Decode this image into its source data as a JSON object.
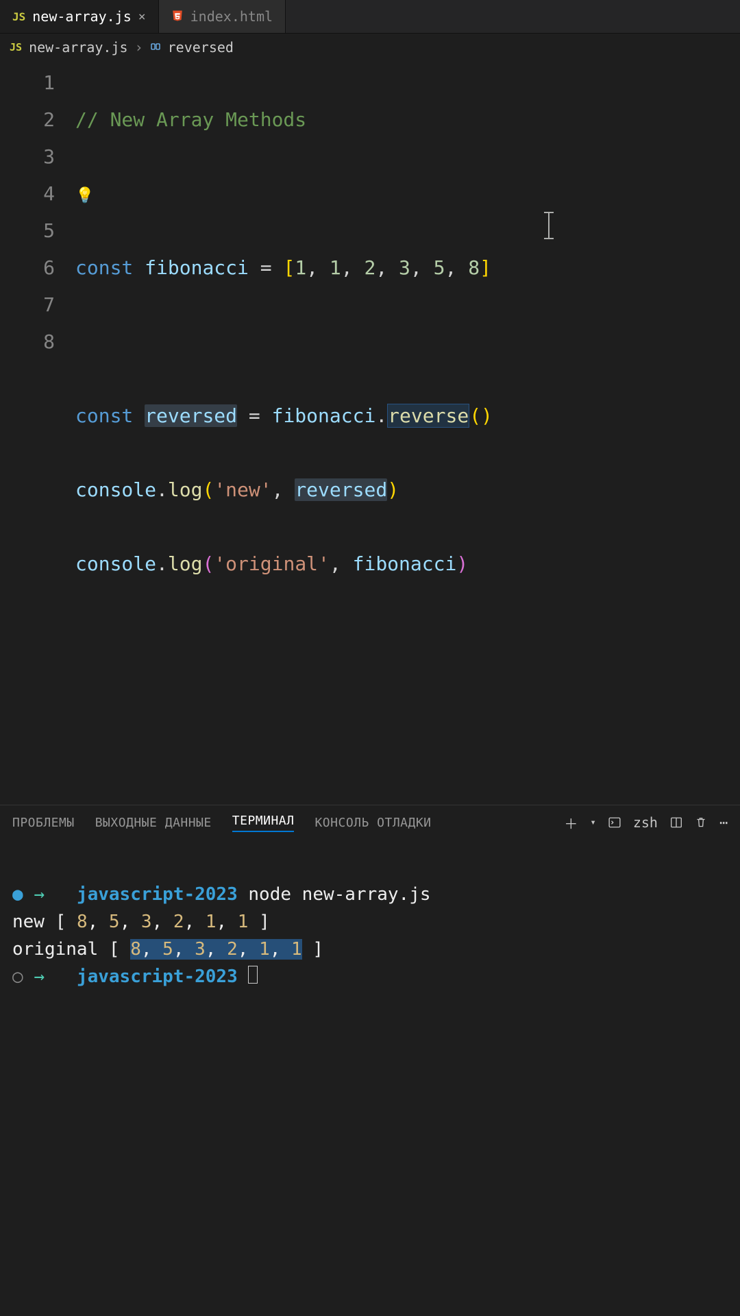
{
  "tabs": [
    {
      "icon": "JS",
      "label": "new-array.js",
      "active": true,
      "closeable": true
    },
    {
      "icon": "html",
      "label": "index.html",
      "active": false,
      "closeable": false
    }
  ],
  "breadcrumb": {
    "file_icon": "JS",
    "file": "new-array.js",
    "symbol": "reversed"
  },
  "code": {
    "lines": [
      "1",
      "2",
      "3",
      "4",
      "5",
      "6",
      "7",
      "8"
    ],
    "l1_comment": "// New Array Methods",
    "l3": {
      "kw": "const",
      "name": "fibonacci",
      "eq": " = ",
      "open": "[",
      "n1": "1",
      "n2": "1",
      "n3": "2",
      "n4": "3",
      "n5": "5",
      "n6": "8",
      "close": "]",
      "comma": ", "
    },
    "l5": {
      "kw": "const",
      "name": "reversed",
      "eq": " = ",
      "obj": "fibonacci",
      "dot": ".",
      "fn": "reverse",
      "paren": "()"
    },
    "l6": {
      "obj": "console",
      "dot": ".",
      "fn": "log",
      "open": "(",
      "s": "'new'",
      "comma": ", ",
      "arg": "reversed",
      "close": ")"
    },
    "l7": {
      "obj": "console",
      "dot": ".",
      "fn": "log",
      "open": "(",
      "s": "'original'",
      "comma": ", ",
      "arg": "fibonacci",
      "close": ")"
    }
  },
  "panel": {
    "tabs": {
      "problems": "ПРОБЛЕМЫ",
      "output": "ВЫХОДНЫЕ ДАННЫЕ",
      "terminal": "ТЕРМИНАЛ",
      "debug": "КОНСОЛЬ ОТЛАДКИ"
    },
    "shell": "zsh"
  },
  "terminal": {
    "prompt_dir": "javascript-2023",
    "cmd": "node new-array.js",
    "out1_label": "new ",
    "out1_vals": [
      "8",
      "5",
      "3",
      "2",
      "1",
      "1"
    ],
    "out2_label": "original ",
    "out2_vals": [
      "8",
      "5",
      "3",
      "2",
      "1",
      "1"
    ]
  }
}
